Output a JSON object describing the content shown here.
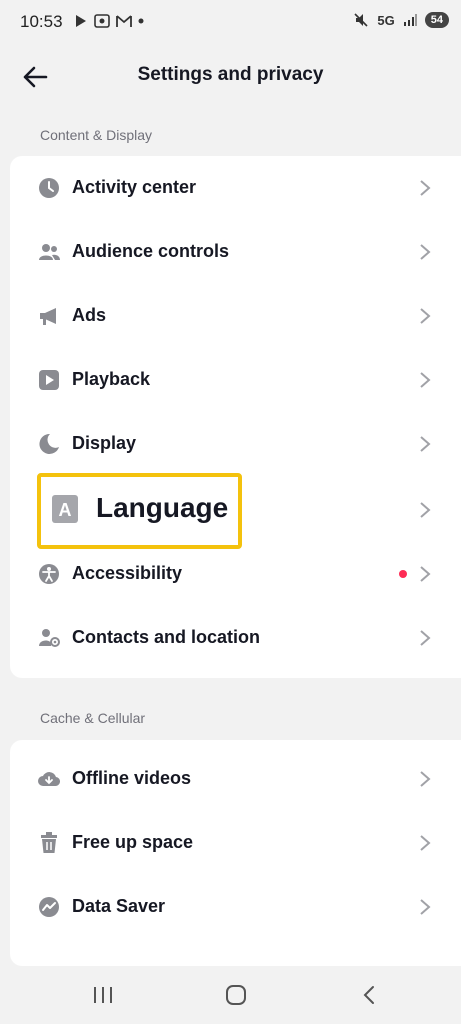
{
  "status": {
    "time": "10:53",
    "network": "5G",
    "battery": "54"
  },
  "header": {
    "title": "Settings and privacy"
  },
  "sections": [
    {
      "label": "Content & Display",
      "items": [
        {
          "label": "Activity center",
          "icon": "clock-icon"
        },
        {
          "label": "Audience controls",
          "icon": "people-icon"
        },
        {
          "label": "Ads",
          "icon": "megaphone-icon"
        },
        {
          "label": "Playback",
          "icon": "play-icon"
        },
        {
          "label": "Display",
          "icon": "moon-icon"
        },
        {
          "label": "Language",
          "icon": "language-icon",
          "highlighted": true
        },
        {
          "label": "Accessibility",
          "icon": "accessibility-icon",
          "badge_dot": true
        },
        {
          "label": "Contacts and location",
          "icon": "contact-location-icon"
        }
      ]
    },
    {
      "label": "Cache & Cellular",
      "items": [
        {
          "label": "Offline videos",
          "icon": "cloud-download-icon"
        },
        {
          "label": "Free up space",
          "icon": "trash-icon"
        },
        {
          "label": "Data Saver",
          "icon": "data-saver-icon"
        }
      ]
    }
  ],
  "colors": {
    "highlight": "#f4c20d",
    "badge": "#fe2c55",
    "icon": "#8a8b91"
  }
}
